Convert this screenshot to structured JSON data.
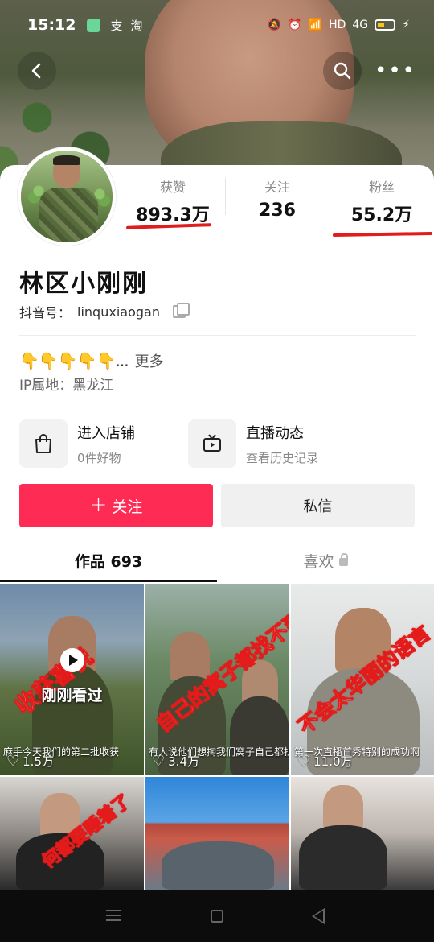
{
  "status_bar": {
    "time": "15:12",
    "icons": [
      "app-icon",
      "alipay-icon",
      "taobao-icon"
    ],
    "right_text": "HD",
    "signal": "4G"
  },
  "profile": {
    "stats": [
      {
        "label": "获赞",
        "value": "893.3万"
      },
      {
        "label": "关注",
        "value": "236"
      },
      {
        "label": "粉丝",
        "value": "55.2万"
      }
    ],
    "name": "林区小刚刚",
    "id_label": "抖音号：",
    "id_value": "linquxiaogan",
    "bio_emojis": "👇👇👇👇👇...",
    "bio_more": "更多",
    "ip_label": "IP属地：",
    "ip_value": "黑龙江",
    "entries": [
      {
        "title": "进入店铺",
        "sub": "0件好物"
      },
      {
        "title": "直播动态",
        "sub": "查看历史记录"
      }
    ],
    "follow_label": "关注",
    "message_label": "私信"
  },
  "tabs": [
    {
      "label": "作品 693"
    },
    {
      "label": "喜欢"
    }
  ],
  "videos": [
    {
      "overlay": "收获喜悦",
      "caption": "麻手今天我们的第二批收获",
      "likes": "1.5万",
      "watched": "刚刚看过"
    },
    {
      "overlay": "自己的窝子都找不到",
      "caption": "有人说他们想掏我们窝子自己都找不到",
      "likes": "3.4万"
    },
    {
      "overlay": "不会太华丽的语言",
      "caption": "第一次直播首秀特别的成功啊",
      "likes": "11.0万"
    },
    {
      "overlay": "何都要睡着了"
    },
    {},
    {}
  ],
  "colors": {
    "accent": "#fe2c55",
    "underline": "#e01c1c"
  }
}
